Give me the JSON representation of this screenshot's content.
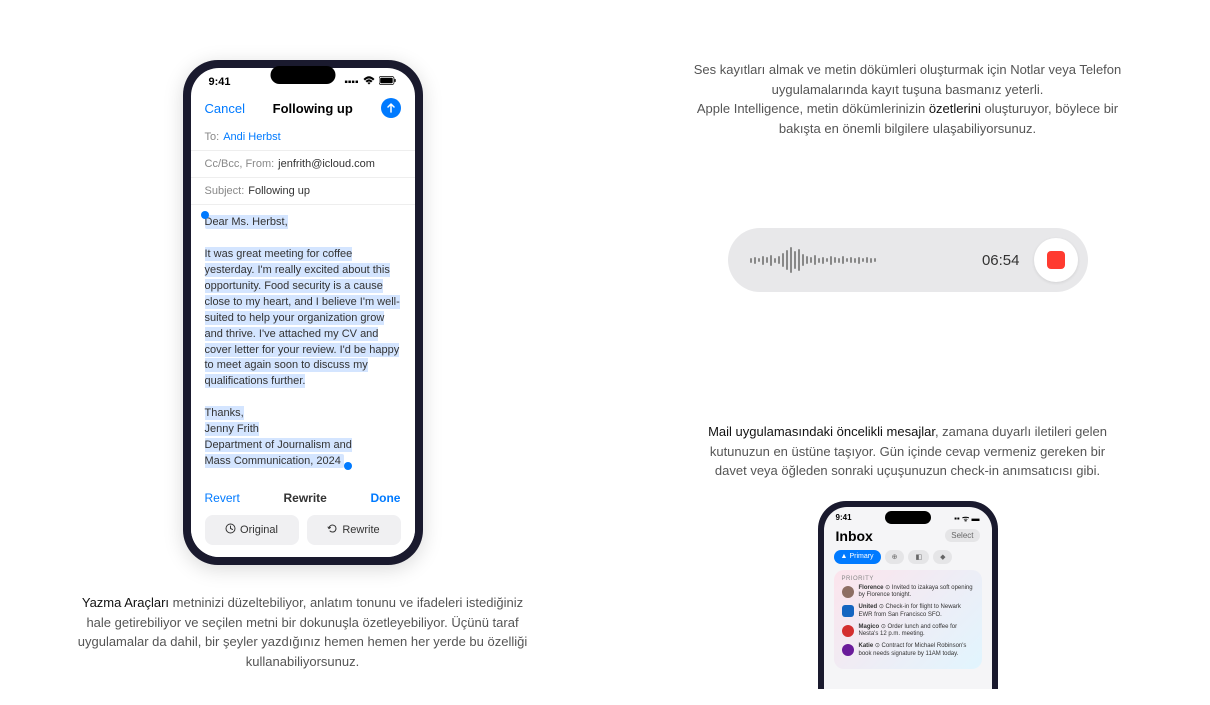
{
  "phone1": {
    "status_time": "9:41",
    "mail": {
      "cancel": "Cancel",
      "title": "Following up",
      "to_label": "To:",
      "to_value": "Andi Herbst",
      "cc_label": "Cc/Bcc, From:",
      "cc_value": "jenfrith@icloud.com",
      "subject_label": "Subject:",
      "subject_value": "Following up",
      "body": {
        "greeting": "Dear Ms. Herbst,",
        "para": "It was great meeting for coffee yesterday. I'm really excited about this opportunity. Food security is a cause close to my heart, and I believe I'm well-suited to help your organization grow and thrive. I've attached my CV and cover letter for your review. I'd be happy to meet again soon to discuss my qualifications further.",
        "thanks": "Thanks,",
        "sig1": "Jenny Frith",
        "sig2": "Department of Journalism and",
        "sig3": "Mass Communication, 2024"
      },
      "footer": {
        "revert": "Revert",
        "rewrite": "Rewrite",
        "done": "Done",
        "original_btn": "Original",
        "rewrite_btn": "Rewrite"
      }
    }
  },
  "caption_left": {
    "bold": "Yazma Araçları",
    "rest": " metninizi düzeltebiliyor, anlatım tonunu ve ifadeleri istediğiniz hale getirebiliyor ve seçilen metni bir dokunuşla özetleyebiliyor. Üçünü taraf uygulamalar da dahil, bir şeyler yazdığınız hemen hemen her yerde bu özelliği kullanabiliyorsunuz."
  },
  "right_text1": {
    "line1": "Ses kayıtları almak ve metin dökümleri oluşturmak için Notlar veya Telefon uygulamalarında kayıt tuşuna basmanız yeterli.",
    "line2a": "Apple Intelligence, metin dökümlerinizin ",
    "bold": "özetlerini",
    "line2b": " oluşturuyor, böylece bir bakışta en önemli bilgilere ulaşabiliyorsunuz."
  },
  "recorder": {
    "time": "06:54"
  },
  "right_text2": {
    "bold": "Mail uygulamasındaki öncelikli mesajlar",
    "rest": ", zamana duyarlı iletileri gelen kutunuzun en üstüne taşıyor. Gün içinde cevap vermeniz gereken bir davet veya öğleden sonraki uçuşunuzun check-in anımsatıcısı gibi."
  },
  "phone2": {
    "status_time": "9:41",
    "inbox_title": "Inbox",
    "select": "Select",
    "tab_primary": "Primary",
    "priority_label": "PRIORITY",
    "rows": [
      {
        "name": "Florence",
        "text": " ⊙ Invited to izakaya soft opening by Florence tonight."
      },
      {
        "name": "United",
        "text": " ⊙ Check-in for flight to Newark EWR from San Francisco SFO."
      },
      {
        "name": "Magico",
        "text": " ⊙ Order lunch and coffee for Nesta's 12 p.m. meeting."
      },
      {
        "name": "Katie",
        "text": " ⊙ Contract for Michael Robinson's book needs signature by 11AM today."
      }
    ]
  }
}
